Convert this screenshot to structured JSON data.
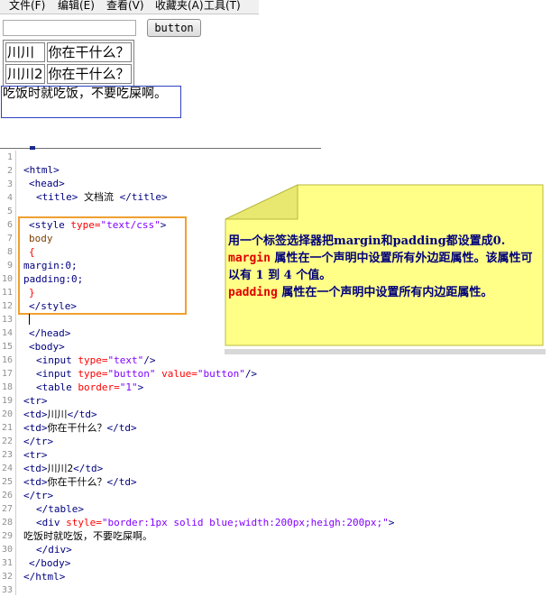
{
  "menu": {
    "items": [
      "文件(F)",
      "编辑(E)",
      "查看(V)",
      "收藏夹(A)",
      "工具(T)"
    ]
  },
  "preview": {
    "input_value": "",
    "button_label": "button",
    "table_rows": [
      [
        "川川",
        "你在干什么？"
      ],
      [
        "川川2",
        "你在干什么？"
      ]
    ],
    "div_text": "吃饭时就吃饭，不要吃屎啊。"
  },
  "editor": {
    "line_numbers": [
      "1",
      "2",
      "3",
      "4",
      "5",
      "6",
      "7",
      "8",
      "9",
      "10",
      "11",
      "12",
      "13",
      "14",
      "15",
      "16",
      "17",
      "18",
      "19",
      "20",
      "21",
      "22",
      "23",
      "24",
      "25",
      "26",
      "27",
      "28",
      "29",
      "30",
      "31",
      "32",
      "33"
    ],
    "code": {
      "l2": "<html>",
      "l3": "<head>",
      "l4_open": "<title>",
      "l4_text": " 文档流 ",
      "l4_close": "</title>",
      "l6_tag": "<style ",
      "l6_attr": "type=",
      "l6_val": "\"text/css\"",
      "l6_end": ">",
      "l7": "body",
      "l8": "{",
      "l9": "margin:0;",
      "l10": "padding:0;",
      "l11": "}",
      "l12": "</style>",
      "l14": "</head>",
      "l15": "<body>",
      "l16_tag": "<input ",
      "l16_attr": "type=",
      "l16_val": "\"text\"",
      "l16_end": "/>",
      "l17_tag": "<input ",
      "l17_attr": "type=",
      "l17_val": "\"button\"",
      "l17_attr2": " value=",
      "l17_val2": "\"button\"",
      "l17_end": "/>",
      "l18_tag": "<table ",
      "l18_attr": "border=",
      "l18_val": "\"1\"",
      "l18_end": ">",
      "l19": "<tr>",
      "l20_open": "<td>",
      "l20_text": "川川",
      "l20_close": "</td>",
      "l21_open": "<td>",
      "l21_text": "你在干什么？",
      "l21_close": "</td>",
      "l22": "</tr>",
      "l23": "<tr>",
      "l24_open": "<td>",
      "l24_text": "川川2",
      "l24_close": "</td>",
      "l25_open": "<td>",
      "l25_text": "你在干什么？",
      "l25_close": "</td>",
      "l26": "</tr>",
      "l27": "</table>",
      "l28_tag": "<div ",
      "l28_attr": "style=",
      "l28_val": "\"border:1px solid blue;width:200px;heigh:200px;\"",
      "l28_end": ">",
      "l29": "吃饭时就吃饭，不要吃屎啊。",
      "l30": "</div>",
      "l31": "</body>",
      "l32": "</html>"
    }
  },
  "note": {
    "line1": "用一个标签选择器把margin和padding都设置成0.",
    "margin_kw": "margin",
    "margin_desc": " 属性在一个声明中设置所有外边距属性。该属性可以有 1 到 4 个值。",
    "padding_kw": "padding",
    "padding_desc": " 属性在一个声明中设置所有内边距属性。"
  },
  "colors": {
    "css_highlight_border": "#f0a030",
    "note_fill": "#ffff88",
    "note_text": "#00007a",
    "keyword_red": "#e00000"
  }
}
